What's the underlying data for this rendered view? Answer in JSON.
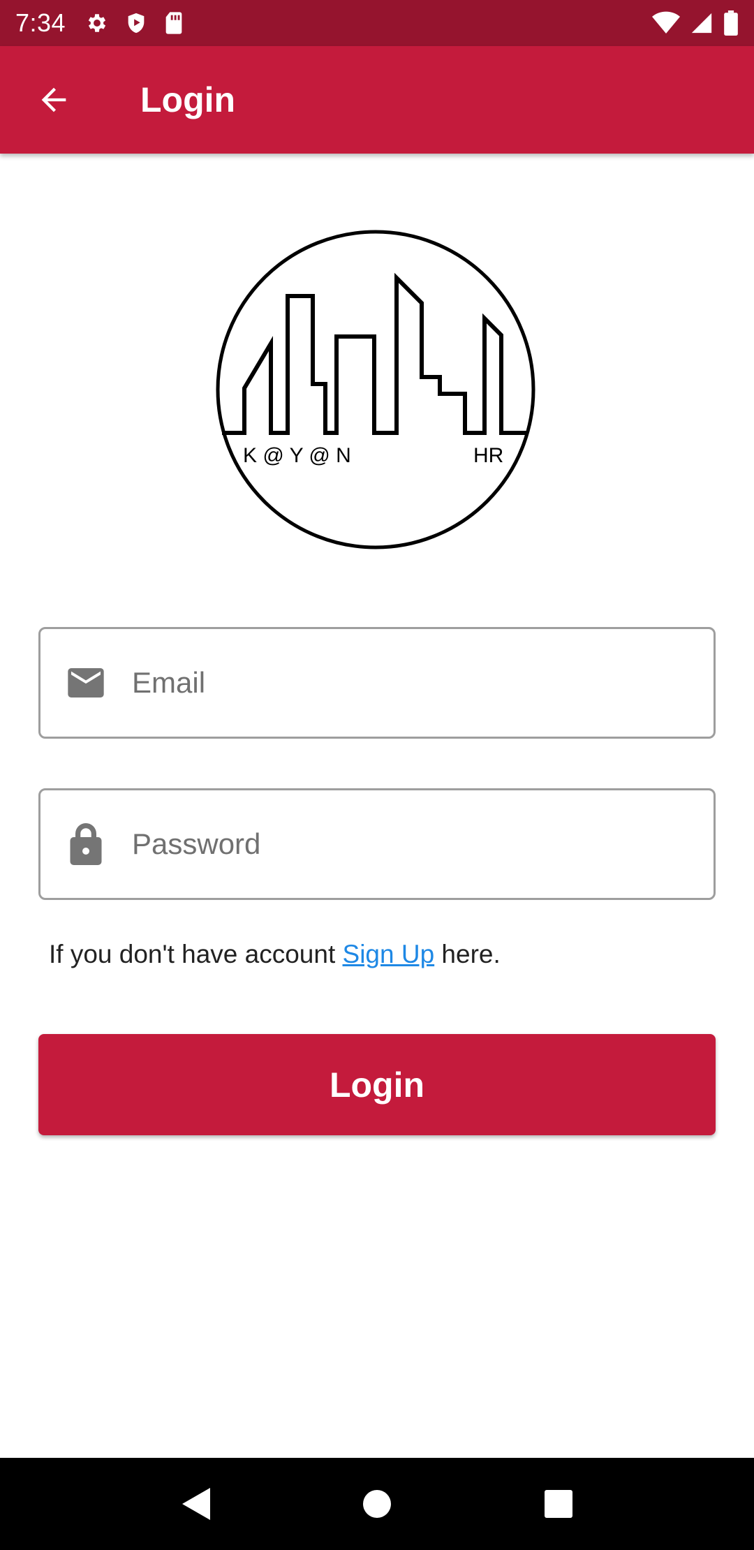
{
  "status_bar": {
    "time": "7:34",
    "icons_left": [
      "gear-icon",
      "shield-play-icon",
      "sd-card-icon"
    ],
    "icons_right": [
      "wifi-icon",
      "cell-signal-icon",
      "battery-icon"
    ],
    "background": "#95142e"
  },
  "app_bar": {
    "title": "Login",
    "back_icon": "arrow-back-icon",
    "background": "#c41b3c"
  },
  "logo": {
    "text_left": "K @ Y @ N",
    "text_right": "HR"
  },
  "form": {
    "email": {
      "placeholder": "Email",
      "value": "",
      "icon": "mail-icon"
    },
    "password": {
      "placeholder": "Password",
      "value": "",
      "icon": "lock-icon"
    },
    "signup": {
      "prefix": "If you don't have account ",
      "link": "Sign Up",
      "suffix": " here.",
      "link_color": "#1e88e5"
    },
    "login_button": {
      "label": "Login",
      "color": "#c41b3c"
    }
  },
  "nav_bar": {
    "buttons": [
      "back-triangle-icon",
      "home-circle-icon",
      "recents-square-icon"
    ]
  }
}
